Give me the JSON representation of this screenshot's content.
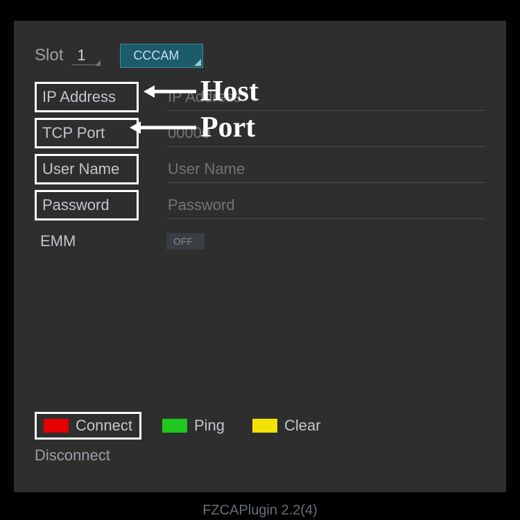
{
  "slot": {
    "label": "Slot",
    "value": "1"
  },
  "protocol": {
    "label": "CCCAM"
  },
  "fields": {
    "ip": {
      "label": "IP Address",
      "placeholder": "IP Address"
    },
    "port": {
      "label": "TCP Port",
      "placeholder": "00000"
    },
    "user": {
      "label": "User Name",
      "placeholder": "User Name"
    },
    "pass": {
      "label": "Password",
      "placeholder": "Password"
    },
    "emm": {
      "label": "EMM",
      "state": "OFF"
    }
  },
  "buttons": {
    "connect": "Connect",
    "ping": "Ping",
    "clear": "Clear",
    "disconnect": "Disconnect"
  },
  "footer": "FZCAPlugin 2.2(4)",
  "annotations": {
    "host": "Host",
    "port": "Port"
  }
}
